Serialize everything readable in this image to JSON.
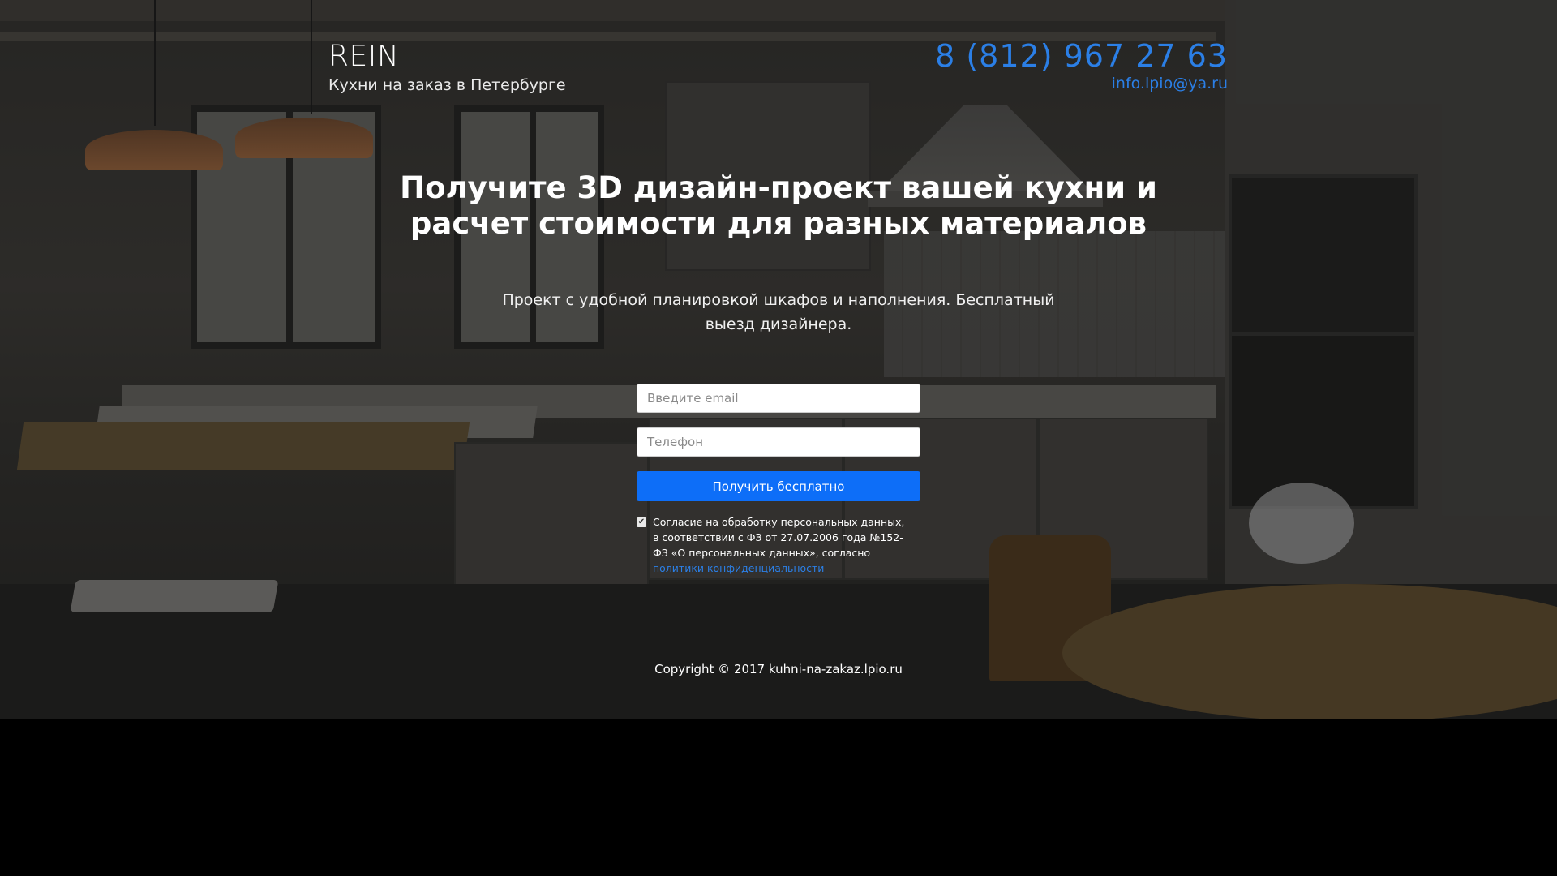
{
  "header": {
    "brand_name": "REIN",
    "brand_tagline": "Кухни на заказ в Петербурге",
    "phone": "8 (812) 967 27 63",
    "email": "info.lpio@ya.ru"
  },
  "hero": {
    "headline": "Получите 3D дизайн-проект вашей кухни и расчет стоимости для разных материалов",
    "subtext": "Проект с удобной планировкой шкафов и наполнения. Бесплатный выезд дизайнера."
  },
  "form": {
    "email_placeholder": "Введите email",
    "phone_placeholder": "Телефон",
    "submit_label": "Получить бесплатно",
    "consent_checked": true,
    "consent_text": "Согласие на обработку персональных данных, в соответствии с ФЗ от 27.07.2006 года №152-ФЗ «О персональных данных», согласно ",
    "consent_link": "политики конфиденциальности"
  },
  "footer": {
    "copyright": "Copyright © 2017 kuhni-na-zakaz.lpio.ru"
  },
  "colors": {
    "accent": "#2b7fe6",
    "button": "#0d6ef8",
    "page_bottom": "#000000"
  }
}
